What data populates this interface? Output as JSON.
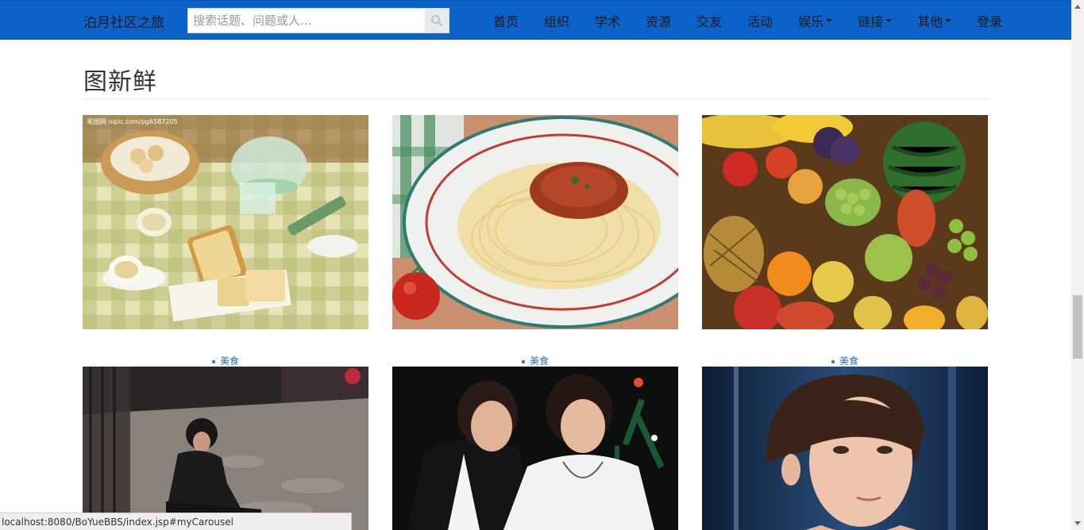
{
  "navbar": {
    "brand": "泊月社区之旅",
    "search_placeholder": "搜索话题、问题或人...",
    "items": [
      {
        "label": "首页",
        "dropdown": false
      },
      {
        "label": "组织",
        "dropdown": false
      },
      {
        "label": "学术",
        "dropdown": false
      },
      {
        "label": "资源",
        "dropdown": false
      },
      {
        "label": "交友",
        "dropdown": false
      },
      {
        "label": "活动",
        "dropdown": false
      },
      {
        "label": "娱乐",
        "dropdown": true
      },
      {
        "label": "链接",
        "dropdown": true
      },
      {
        "label": "其他",
        "dropdown": true
      },
      {
        "label": "登录",
        "dropdown": false
      }
    ],
    "colors": {
      "background": "#0b62c9"
    }
  },
  "section": {
    "title": "图新鲜"
  },
  "gallery": {
    "row1": [
      {
        "image": "bread-and-tea-photo",
        "watermark": "昵图网 nipic.com/pg6587205",
        "caption": "美食"
      },
      {
        "image": "spaghetti-photo",
        "caption": "美食"
      },
      {
        "image": "fruit-pile-photo",
        "caption": "美食"
      }
    ],
    "row2": [
      {
        "image": "man-sitting-photo"
      },
      {
        "image": "two-young-men-photo"
      },
      {
        "image": "man-portrait-photo"
      }
    ]
  },
  "statusbar": {
    "url": "localhost:8080/BoYueBBS/index.jsp#myCarousel"
  }
}
